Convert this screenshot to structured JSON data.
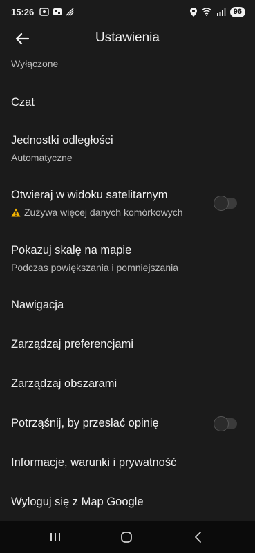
{
  "status_bar": {
    "time": "15:26",
    "battery": "96"
  },
  "app_bar": {
    "title": "Ustawienia"
  },
  "settings": {
    "items": [
      {
        "title": "",
        "subtitle": "Wyłączone"
      },
      {
        "title": "Czat"
      },
      {
        "title": "Jednostki odległości",
        "subtitle": "Automatyczne"
      },
      {
        "title": "Otwieraj w widoku satelitarnym",
        "subtitle": "Zużywa więcej danych komórkowych",
        "toggle": false
      },
      {
        "title": "Pokazuj skalę na mapie",
        "subtitle": "Podczas powiększania i pomniejszania"
      },
      {
        "title": "Nawigacja"
      },
      {
        "title": "Zarządzaj preferencjami"
      },
      {
        "title": "Zarządzaj obszarami"
      },
      {
        "title": "Potrząśnij, by przesłać opinię",
        "toggle": false
      },
      {
        "title": "Informacje, warunki i prywatność"
      },
      {
        "title": "Wyloguj się z Map Google"
      }
    ]
  },
  "colors": {
    "background": "#1b1b1b",
    "text": "#efefef",
    "subtext": "#bdbdbd",
    "warning": "#f4b400",
    "nav_bar": "#0b0b0b"
  },
  "icons": {
    "back": "arrow-left-icon",
    "warning": "warning-triangle-icon",
    "nav_recents": "recent-apps-icon",
    "nav_home": "home-icon",
    "nav_back": "back-chevron-icon"
  }
}
